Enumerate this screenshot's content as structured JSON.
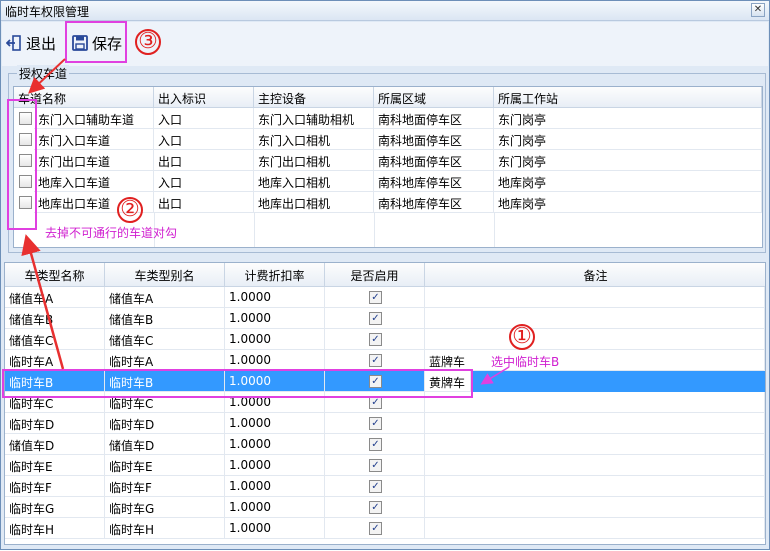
{
  "window": {
    "title": "临时车权限管理",
    "close_glyph": "✕"
  },
  "toolbar": {
    "exit_label": "退出",
    "save_label": "保存"
  },
  "lanes": {
    "group_title": "授权车道",
    "columns": [
      "车道名称",
      "出入标识",
      "主控设备",
      "所属区域",
      "所属工作站"
    ],
    "rows": [
      {
        "name": "东门入口辅助车道",
        "direction": "入口",
        "device": "东门入口辅助相机",
        "area": "南科地面停车区",
        "station": "东门岗亭",
        "checked": false
      },
      {
        "name": "东门入口车道",
        "direction": "入口",
        "device": "东门入口相机",
        "area": "南科地面停车区",
        "station": "东门岗亭",
        "checked": false
      },
      {
        "name": "东门出口车道",
        "direction": "出口",
        "device": "东门出口相机",
        "area": "南科地面停车区",
        "station": "东门岗亭",
        "checked": false
      },
      {
        "name": "地库入口车道",
        "direction": "入口",
        "device": "地库入口相机",
        "area": "南科地库停车区",
        "station": "地库岗亭",
        "checked": false
      },
      {
        "name": "地库出口车道",
        "direction": "出口",
        "device": "地库出口相机",
        "area": "南科地库停车区",
        "station": "地库岗亭",
        "checked": false
      }
    ]
  },
  "vehicle_types": {
    "columns": [
      "车类型名称",
      "车类型别名",
      "计费折扣率",
      "是否启用",
      "备注"
    ],
    "rows": [
      {
        "name": "储值车A",
        "alias": "储值车A",
        "rate": "1.0000",
        "enabled": true,
        "note": ""
      },
      {
        "name": "储值车B",
        "alias": "储值车B",
        "rate": "1.0000",
        "enabled": true,
        "note": ""
      },
      {
        "name": "储值车C",
        "alias": "储值车C",
        "rate": "1.0000",
        "enabled": true,
        "note": ""
      },
      {
        "name": "临时车A",
        "alias": "临时车A",
        "rate": "1.0000",
        "enabled": true,
        "note": "蓝牌车"
      },
      {
        "name": "临时车B",
        "alias": "临时车B",
        "rate": "1.0000",
        "enabled": true,
        "note": "黄牌车",
        "selected": true
      },
      {
        "name": "临时车C",
        "alias": "临时车C",
        "rate": "1.0000",
        "enabled": true,
        "note": ""
      },
      {
        "name": "临时车D",
        "alias": "临时车D",
        "rate": "1.0000",
        "enabled": true,
        "note": ""
      },
      {
        "name": "储值车D",
        "alias": "储值车D",
        "rate": "1.0000",
        "enabled": true,
        "note": ""
      },
      {
        "name": "临时车E",
        "alias": "临时车E",
        "rate": "1.0000",
        "enabled": true,
        "note": ""
      },
      {
        "name": "临时车F",
        "alias": "临时车F",
        "rate": "1.0000",
        "enabled": true,
        "note": ""
      },
      {
        "name": "临时车G",
        "alias": "临时车G",
        "rate": "1.0000",
        "enabled": true,
        "note": ""
      },
      {
        "name": "临时车H",
        "alias": "临时车H",
        "rate": "1.0000",
        "enabled": true,
        "note": ""
      }
    ]
  },
  "annotations": {
    "step1_text": "选中临时车B",
    "step2_text": "去掉不可通行的车道对勾",
    "num1": "①",
    "num2": "②",
    "num3": "③",
    "color": "#e040e0"
  }
}
